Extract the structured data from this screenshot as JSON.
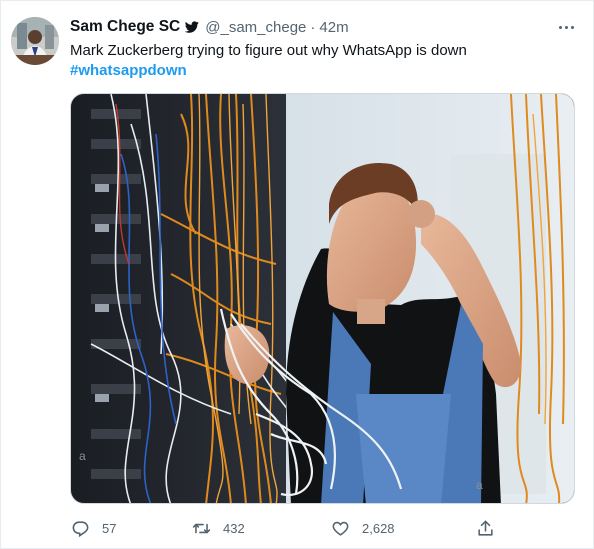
{
  "tweet": {
    "author_name": "Sam Chege SC",
    "handle": "@_sam_chege",
    "separator": "·",
    "time": "42m",
    "text": "Mark Zuckerberg trying to figure out why WhatsApp is down",
    "hashtag": "#whatsappdown",
    "watermark": "a",
    "icons": {
      "verified": "verified-bird-icon",
      "more": "more-options-icon",
      "reply": "reply-icon",
      "retweet": "retweet-icon",
      "like": "heart-icon",
      "share": "share-icon"
    },
    "colors": {
      "accent": "#1d9bf0",
      "muted": "#536471",
      "text": "#0f1419"
    }
  },
  "actions": {
    "replies": "57",
    "retweets": "432",
    "likes": "2,628"
  }
}
